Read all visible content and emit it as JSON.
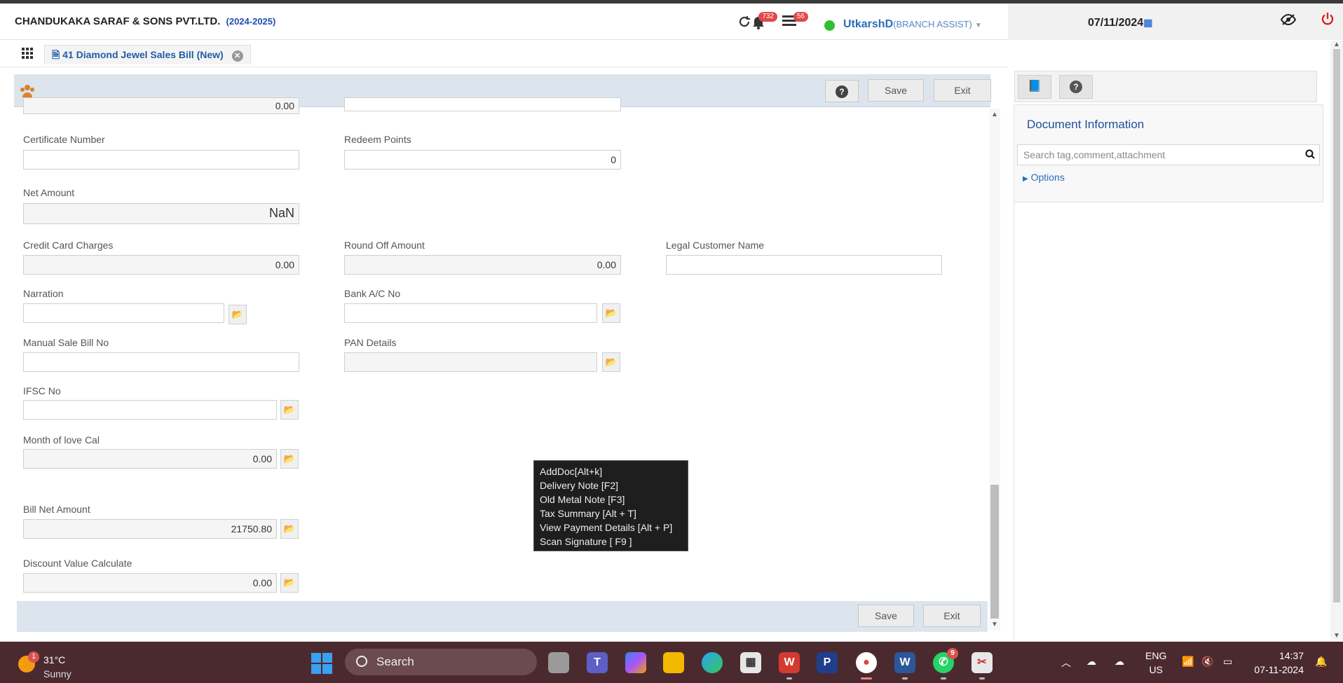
{
  "header": {
    "company": "CHANDUKAKA SARAF & SONS PVT.LTD.",
    "year": "(2024-2025)",
    "notifications_count": "732",
    "tasks_count": "56",
    "user_name": "UtkarshD",
    "user_role": "(BRANCH ASSIST)",
    "date": "07/11/2024"
  },
  "tab": {
    "label": "41 Diamond Jewel Sales Bill (New)"
  },
  "toolbar": {
    "save_label": "Save",
    "exit_label": "Exit"
  },
  "form": {
    "top_partial_value": "0.00",
    "certificate_number": {
      "label": "Certificate Number",
      "value": ""
    },
    "redeem_points": {
      "label": "Redeem Points",
      "value": "0"
    },
    "net_amount": {
      "label": "Net Amount",
      "value": "NaN"
    },
    "credit_card_charges": {
      "label": "Credit Card Charges",
      "value": "0.00"
    },
    "round_off_amount": {
      "label": "Round Off Amount",
      "value": "0.00"
    },
    "legal_customer_name": {
      "label": "Legal Customer Name",
      "value": ""
    },
    "narration": {
      "label": "Narration",
      "value": ""
    },
    "bank_ac_no": {
      "label": "Bank A/C No",
      "value": ""
    },
    "manual_sale_bill_no": {
      "label": "Manual Sale Bill No",
      "value": ""
    },
    "pan_details": {
      "label": "PAN Details",
      "value": ""
    },
    "ifsc_no": {
      "label": "IFSC No",
      "value": ""
    },
    "month_of_love_cal": {
      "label": "Month of love Cal",
      "value": "0.00"
    },
    "bill_net_amount": {
      "label": "Bill Net Amount",
      "value": "21750.80"
    },
    "discount_value_calculate": {
      "label": "Discount Value Calculate",
      "value": "0.00"
    }
  },
  "context_menu": {
    "items": [
      "AddDoc[Alt+k]",
      "Delivery Note [F2]",
      "Old Metal Note [F3]",
      "Tax Summary [Alt + T]",
      "View Payment Details [Alt + P]",
      "Scan Signature [ F9 ]"
    ]
  },
  "bottom": {
    "save_label": "Save",
    "exit_label": "Exit"
  },
  "right_panel": {
    "title": "Document Information",
    "search_placeholder": "Search tag,comment,attachment",
    "options_label": "Options"
  },
  "taskbar": {
    "weather_badge": "1",
    "temperature": "31°C",
    "condition": "Sunny",
    "search_label": "Search",
    "whatsapp_count": "9",
    "lang_line1": "ENG",
    "lang_line2": "US",
    "time": "14:37",
    "date": "07-11-2024"
  },
  "colors": {
    "accent": "#2a6dba",
    "toolbar_bg": "#dce5ed",
    "taskbar_bg": "#4b2a2f",
    "status_online": "#2ec033",
    "badge_red": "#e24848"
  },
  "icons": [
    "refresh-icon",
    "bell-icon",
    "task-list-icon",
    "calendar-icon",
    "eye-slash-icon",
    "power-icon",
    "apps-grid-icon",
    "document-icon",
    "close-icon",
    "people-icon",
    "help-icon",
    "folder-open-icon",
    "book-icon",
    "search-icon",
    "caret-right-icon"
  ]
}
